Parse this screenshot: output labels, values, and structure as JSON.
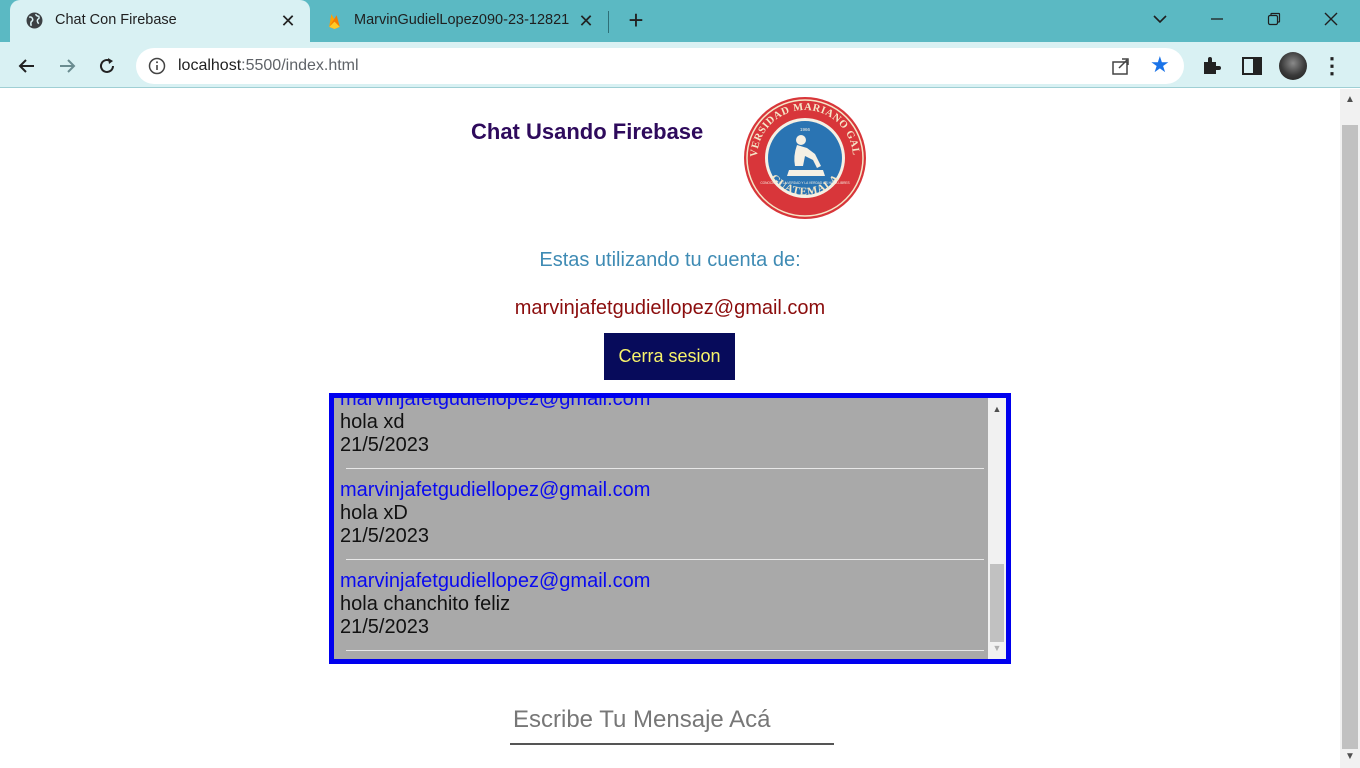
{
  "browser": {
    "tabs": [
      {
        "title": "Chat Con Firebase",
        "active": true,
        "icon": "globe-icon"
      },
      {
        "title": "MarvinGudielLopez090-23-12821",
        "active": false,
        "icon": "firebase-icon"
      }
    ],
    "url_host": "localhost",
    "url_rest": ":5500/index.html",
    "accent_color": "#5bb9c3",
    "star_color": "#1a73e8"
  },
  "page": {
    "title": "Chat Usando Firebase",
    "logo_alt": "Universidad Mariano Galvez Guatemala logo",
    "logo_text_top": "UNIVERSIDAD MARIANO GALVEZ",
    "logo_text_bottom": "GUATEMALA",
    "logo_year": "1966",
    "logo_motto": "CONOCERÉIS LA VERDAD Y LA VERDAD OS HARÁ LIBRES",
    "account_label": "Estas utilizando tu cuenta de:",
    "account_email": "marvinjafetgudiellopez@gmail.com",
    "logout_label": "Cerra sesion",
    "input_placeholder": "Escribe Tu Mensaje Acá"
  },
  "chat": {
    "partial_top_user": "marvinjafetgudiellopez@gmail.com",
    "messages": [
      {
        "user": "marvinjafetgudiellopez@gmail.com",
        "text": "hola xd",
        "date": "21/5/2023"
      },
      {
        "user": "marvinjafetgudiellopez@gmail.com",
        "text": "hola xD",
        "date": "21/5/2023"
      },
      {
        "user": "marvinjafetgudiellopez@gmail.com",
        "text": "hola chanchito feliz",
        "date": "21/5/2023"
      }
    ]
  }
}
